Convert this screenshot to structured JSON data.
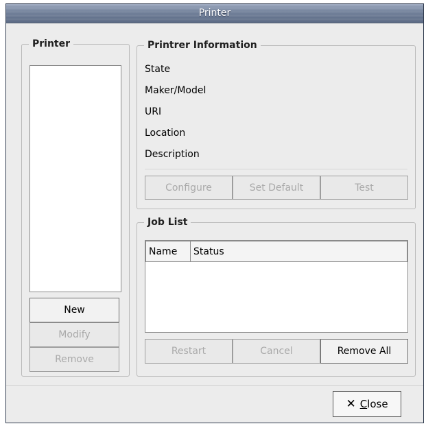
{
  "window": {
    "title": "Printer"
  },
  "printer_panel": {
    "legend": "Printer",
    "buttons": {
      "new": "New",
      "modify": "Modify",
      "remove": "Remove"
    }
  },
  "info_panel": {
    "legend": "Printrer Information",
    "labels": [
      "State",
      "Maker/Model",
      "URI",
      "Location",
      "Description"
    ],
    "buttons": {
      "configure": "Configure",
      "set_default": "Set Default",
      "test": "Test"
    }
  },
  "job_panel": {
    "legend": "Job List",
    "columns": [
      "Name",
      "Status"
    ],
    "buttons": {
      "restart": "Restart",
      "cancel": "Cancel",
      "remove_all": "Remove All"
    }
  },
  "footer": {
    "close_label": "Close",
    "close_mnemonic": "C",
    "close_rest": "lose",
    "close_icon": "x-icon"
  }
}
